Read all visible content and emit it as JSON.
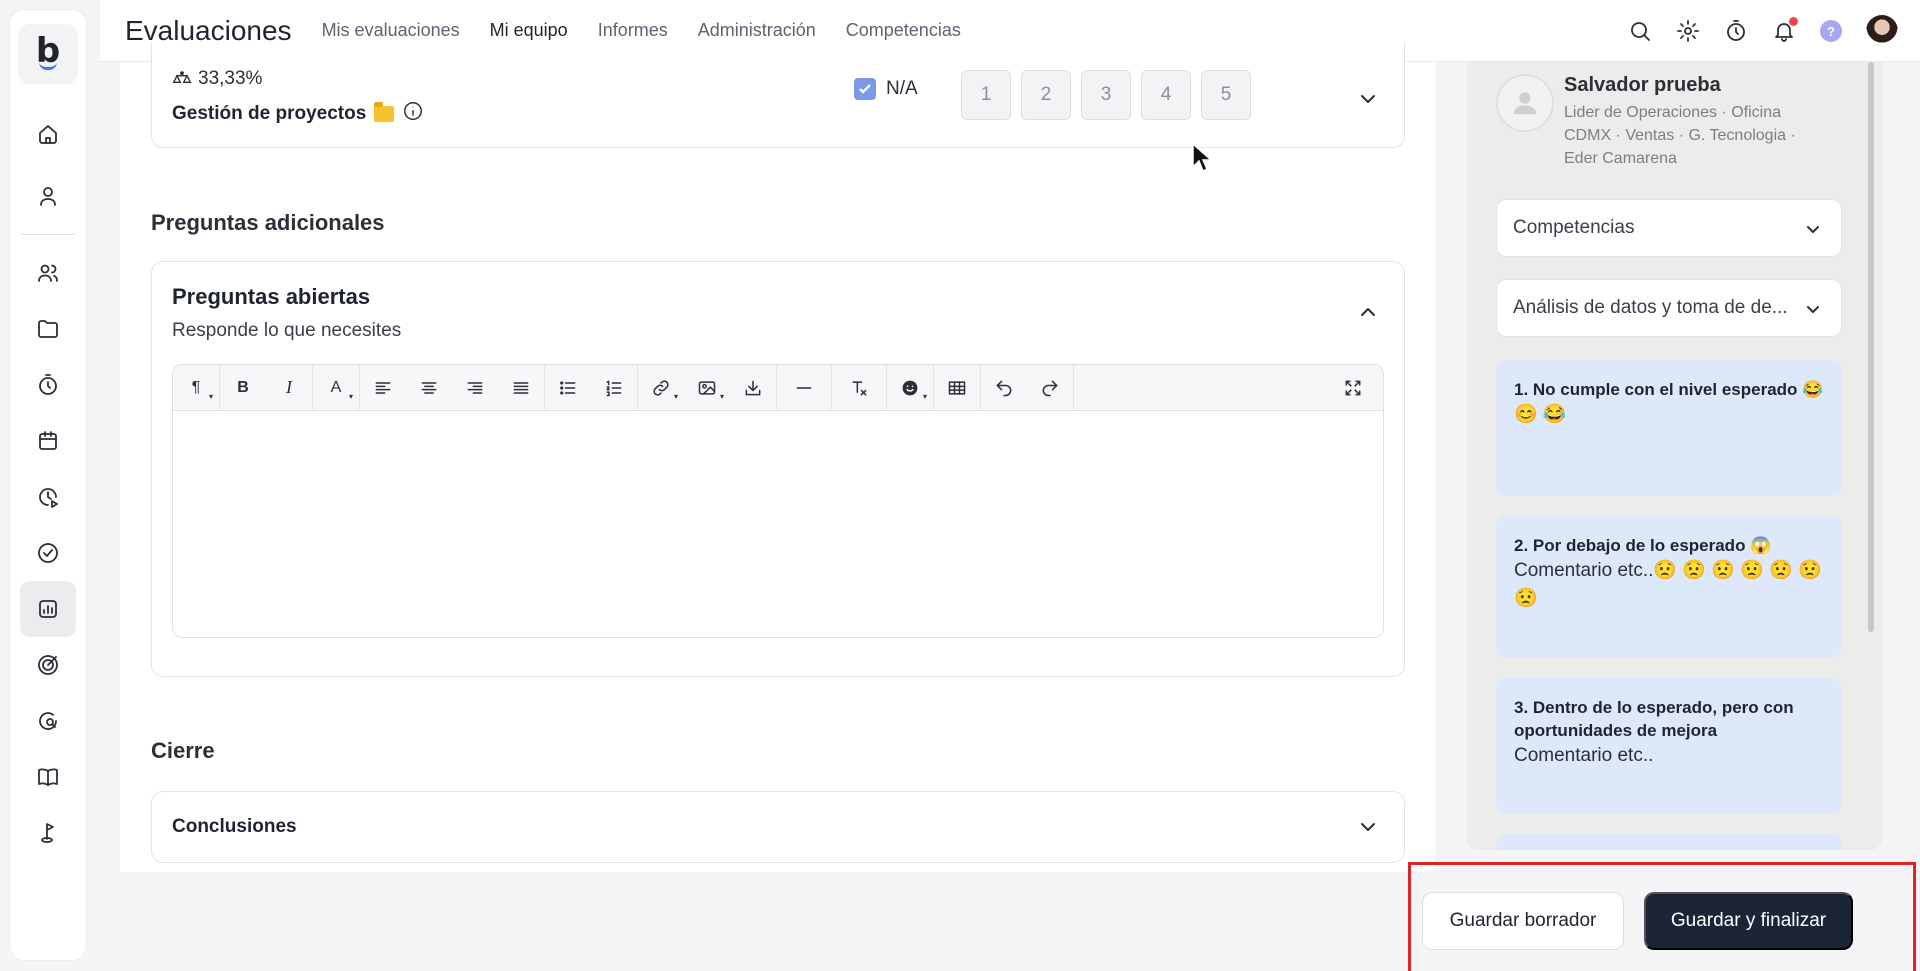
{
  "header": {
    "title": "Evaluaciones",
    "tabs": [
      {
        "label": "Mis evaluaciones"
      },
      {
        "label": "Mi equipo"
      },
      {
        "label": "Informes"
      },
      {
        "label": "Administración"
      },
      {
        "label": "Competencias"
      }
    ],
    "active_tab": "Mi equipo",
    "help_label": "?"
  },
  "sidebar": {
    "logo_letter": "b",
    "items": [
      "home-icon",
      "user-icon",
      "users-icon",
      "folder-icon",
      "timer-icon",
      "calendar-icon",
      "clock-play-icon",
      "check-circle-icon",
      "chart-icon",
      "target-icon",
      "chat-search-icon",
      "book-icon",
      "golf-icon"
    ],
    "active_item": "chart-icon"
  },
  "competency": {
    "weight": "33,33%",
    "title": "Gestión de proyectos",
    "na_label": "N/A",
    "na_checked": true,
    "scale": [
      "1",
      "2",
      "3",
      "4",
      "5"
    ]
  },
  "additional": {
    "section_title": "Preguntas adicionales",
    "card_title": "Preguntas abiertas",
    "card_subtitle": "Responde lo que necesites",
    "editor_value": ""
  },
  "closing": {
    "section_title": "Cierre",
    "card_title": "Conclusiones"
  },
  "right_panel": {
    "person": {
      "name": "Salvador prueba",
      "description": "Lider de Operaciones · Oficina CDMX · Ventas · G. Tecnologia · Eder Camarena"
    },
    "select_category": "Competencias",
    "select_competency": "Análisis de datos y toma de de...",
    "levels": [
      {
        "title": "1. No cumple con el nivel esperado 😂",
        "text": "😊 😂"
      },
      {
        "title": "2. Por debajo de lo esperado 😱",
        "text": "Comentario etc..😟 😟 😟 😟 😟 😟 😟"
      },
      {
        "title": "3. Dentro de lo esperado, pero con oportunidades de mejora",
        "text": "Comentario etc.."
      }
    ]
  },
  "footer": {
    "save_draft_label": "Guardar borrador",
    "save_finish_label": "Guardar y finalizar"
  },
  "colors": {
    "primary_button": "#1b2537",
    "level_card_bg": "#dde9fa",
    "checkbox": "#7c98e8",
    "highlight_frame": "#e02424"
  }
}
